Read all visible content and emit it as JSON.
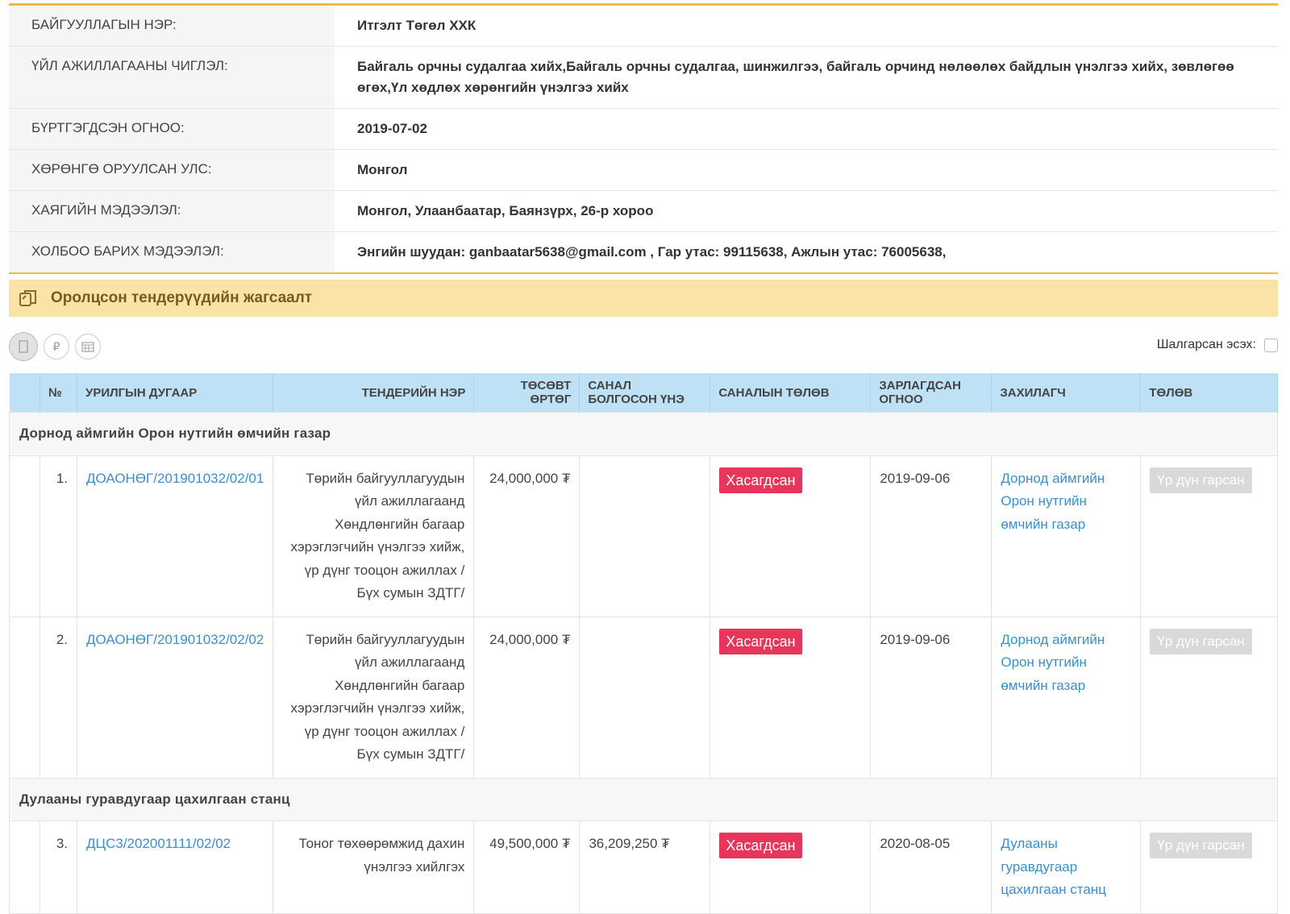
{
  "org_info": {
    "rows": [
      {
        "label": "БАЙГУУЛЛАГЫН НЭР:",
        "value": "Итгэлт Төгөл ХХК"
      },
      {
        "label": "ҮЙЛ АЖИЛЛАГААНЫ ЧИГЛЭЛ:",
        "value": "Байгаль орчны судалгаа хийх,Байгаль орчны судалгаа, шинжилгээ, байгаль орчинд нөлөөлөх байдлын үнэлгээ хийх, зөвлөгөө өгөх,Үл хөдлөх хөрөнгийн үнэлгээ хийх"
      },
      {
        "label": "БҮРТГЭГДСЭН ОГНОО:",
        "value": "2019-07-02"
      },
      {
        "label": "ХӨРӨНГӨ ОРУУЛСАН УЛС:",
        "value": "Монгол"
      },
      {
        "label": "ХАЯГИЙН МЭДЭЭЛЭЛ:",
        "value": "Монгол, Улаанбаатар, Баянзүрх, 26-р хороо"
      },
      {
        "label": "ХОЛБОО БАРИХ МЭДЭЭЛЭЛ:",
        "value": "Энгийн шуудан: ganbaatar5638@gmail.com , Гар утас: 99115638, Ажлын утас: 76005638,"
      }
    ]
  },
  "section": {
    "title": "Оролцсон тендерүүдийн жагсаалт",
    "icon": "copy-icon"
  },
  "toolbar": {
    "icons": [
      "building-icon",
      "currency-icon",
      "calendar-icon"
    ]
  },
  "filter": {
    "label": "Шалгарсан эсэх:"
  },
  "table": {
    "headers": [
      "№",
      "УРИЛГЫН ДУГААР",
      "ТЕНДЕРИЙН НЭР",
      "ТӨСӨВТ ӨРТӨГ",
      "САНАЛ БОЛГОСОН ҮНЭ",
      "САНАЛЫН ТӨЛӨВ",
      "ЗАРЛАГДСАН ОГНОО",
      "ЗАХИЛАГЧ",
      "ТӨЛӨВ"
    ],
    "groups": [
      {
        "name": "Дорнод аймгийн Орон нутгийн өмчийн газар",
        "rows": [
          {
            "num": "1.",
            "code": "ДОАОНӨГ/201901032/02/01",
            "name": "Төрийн байгууллагуудын үйл ажиллагаанд Хөндлөнгийн багаар хэрэглэгчийн үнэлгээ хийж, үр дүнг тооцон ажиллах / Бүх сумын ЗДТГ/",
            "budget": "24,000,000 ₮",
            "offer": "",
            "status": "Хасагдсан",
            "date": "2019-09-06",
            "client": "Дорнод аймгийн Орон нутгийн өмчийн газар",
            "state": "Үр дүн гарсан"
          },
          {
            "num": "2.",
            "code": "ДОАОНӨГ/201901032/02/02",
            "name": "Төрийн байгууллагуудын үйл ажиллагаанд Хөндлөнгийн багаар хэрэглэгчийн үнэлгээ хийж, үр дүнг тооцон ажиллах / Бүх сумын ЗДТГ/",
            "budget": "24,000,000 ₮",
            "offer": "",
            "status": "Хасагдсан",
            "date": "2019-09-06",
            "client": "Дорнод аймгийн Орон нутгийн өмчийн газар",
            "state": "Үр дүн гарсан"
          }
        ]
      },
      {
        "name": "Дулааны гуравдугаар цахилгаан станц",
        "rows": [
          {
            "num": "3.",
            "code": "ДЦС3/202001111/02/02",
            "name": "Тоног төхөөрөмжид дахин үнэлгээ хийлгэх",
            "budget": "49,500,000 ₮",
            "offer": "36,209,250 ₮",
            "status": "Хасагдсан",
            "date": "2020-08-05",
            "client": "Дулааны гуравдугаар цахилгаан станц",
            "state": "Үр дүн гарсан"
          }
        ]
      }
    ]
  },
  "colors": {
    "accent": "#f5b942",
    "header_bg": "#bfe1f6",
    "section_bg": "#fbe2a7",
    "danger": "#e8365b",
    "link": "#3b8fcc"
  }
}
